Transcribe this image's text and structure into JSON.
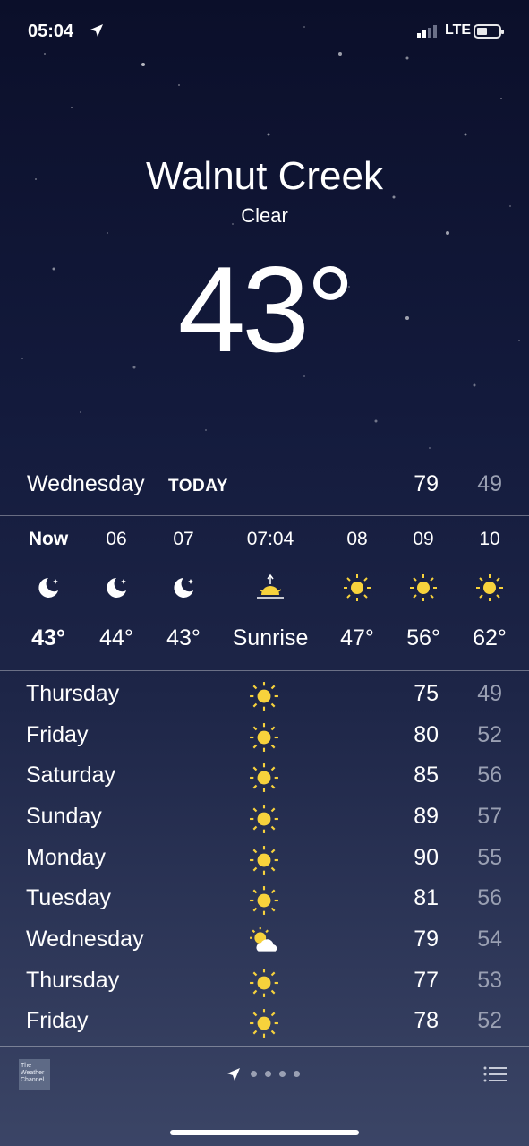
{
  "status_bar": {
    "time": "05:04",
    "network": "LTE"
  },
  "location": {
    "city": "Walnut Creek",
    "condition": "Clear",
    "temperature": "43°"
  },
  "today": {
    "day": "Wednesday",
    "tag": "TODAY",
    "high": "79",
    "low": "49"
  },
  "hourly": [
    {
      "label": "Now",
      "icon": "moon-icon",
      "value": "43°"
    },
    {
      "label": "06",
      "icon": "moon-icon",
      "value": "44°"
    },
    {
      "label": "07",
      "icon": "moon-icon",
      "value": "43°"
    },
    {
      "label": "07:04",
      "icon": "sunrise-icon",
      "value": "Sunrise"
    },
    {
      "label": "08",
      "icon": "sun-icon",
      "value": "47°"
    },
    {
      "label": "09",
      "icon": "sun-icon",
      "value": "56°"
    },
    {
      "label": "10",
      "icon": "sun-icon",
      "value": "62°"
    }
  ],
  "daily": [
    {
      "day": "Thursday",
      "icon": "sun-icon",
      "high": "75",
      "low": "49"
    },
    {
      "day": "Friday",
      "icon": "sun-icon",
      "high": "80",
      "low": "52"
    },
    {
      "day": "Saturday",
      "icon": "sun-icon",
      "high": "85",
      "low": "56"
    },
    {
      "day": "Sunday",
      "icon": "sun-icon",
      "high": "89",
      "low": "57"
    },
    {
      "day": "Monday",
      "icon": "sun-icon",
      "high": "90",
      "low": "55"
    },
    {
      "day": "Tuesday",
      "icon": "sun-icon",
      "high": "81",
      "low": "56"
    },
    {
      "day": "Wednesday",
      "icon": "partly-cloudy-icon",
      "high": "79",
      "low": "54"
    },
    {
      "day": "Thursday",
      "icon": "sun-icon",
      "high": "77",
      "low": "53"
    },
    {
      "day": "Friday",
      "icon": "sun-icon",
      "high": "78",
      "low": "52"
    }
  ],
  "footer": {
    "logo_text": "The Weather Channel"
  },
  "colors": {
    "sun": "#f7d23c",
    "low_temp": "#9aa0b3",
    "background_top": "#0b0f2a",
    "background_bottom": "#3b4566"
  }
}
